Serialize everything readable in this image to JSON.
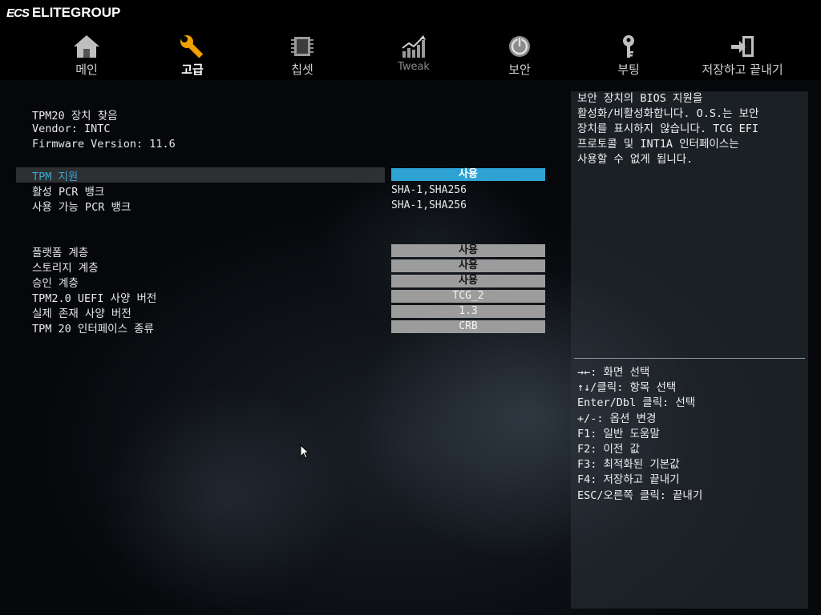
{
  "brand": {
    "ecs": "ECS",
    "name": "ELITEGROUP"
  },
  "tabs": [
    {
      "label": "메인",
      "icon": "home-icon"
    },
    {
      "label": "고급",
      "icon": "wrench-icon"
    },
    {
      "label": "칩셋",
      "icon": "chip-icon"
    },
    {
      "label": "Tweak",
      "icon": "chart-icon"
    },
    {
      "label": "보안",
      "icon": "power-lock-icon"
    },
    {
      "label": "부팅",
      "icon": "key-icon"
    },
    {
      "label": "저장하고 끝내기",
      "icon": "exit-icon"
    }
  ],
  "active_tab": "고급",
  "info": {
    "title": "TPM20 장치 찾음",
    "vendor": "Vendor: INTC",
    "firmware": "Firmware Version: 11.6"
  },
  "settings": [
    {
      "label": "TPM 지원",
      "value": "사용"
    },
    {
      "label": "활성 PCR 뱅크",
      "value": "SHA-1,SHA256"
    },
    {
      "label": "사용 가능 PCR 뱅크",
      "value": "SHA-1,SHA256"
    },
    {
      "label": "플랫폼 계층",
      "value": "사용"
    },
    {
      "label": "스토리지 계층",
      "value": "사용"
    },
    {
      "label": "승인 계층",
      "value": "사용"
    },
    {
      "label": "TPM2.0 UEFI 사양 버전",
      "value": "TCG_2"
    },
    {
      "label": "실제 존재 사양 버전",
      "value": "1.3"
    },
    {
      "label": "TPM 20 인터페이스 종류",
      "value": "CRB"
    }
  ],
  "help": {
    "description": "보안 장치의 BIOS 지원을\n활성화/비활성화합니다. O.S.는 보안\n장치를 표시하지 않습니다. TCG EFI\n프로토콜 및 INT1A 인터페이스는\n사용할 수 없게 됩니다.",
    "keys": [
      "→←: 화면 선택",
      "↑↓/클릭: 항목 선택",
      "Enter/Dbl 클릭: 선택",
      "+/-: 옵션 변경",
      "F1: 일반 도움말",
      "F2: 이전 값",
      "F3: 최적화된 기본값",
      "F4: 저장하고 끝내기",
      "ESC/오른쪽 클릭: 끝내기"
    ]
  },
  "colors": {
    "accent": "#2ea2d2",
    "selected_text": "#3aa7d4",
    "value_bg": "#9c9c9c"
  }
}
